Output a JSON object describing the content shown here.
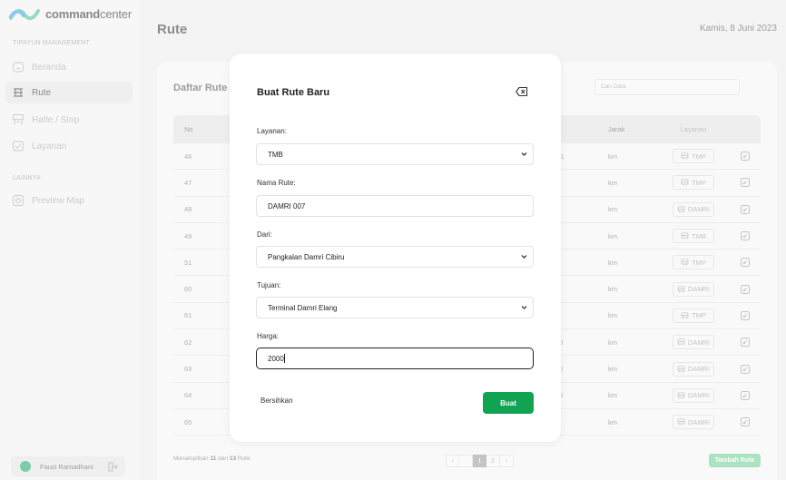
{
  "app": {
    "name_bold": "command",
    "name_rest": "center"
  },
  "sidebar": {
    "section_main": "TIPAYUN MANAGEMENT",
    "items": [
      {
        "label": "Beranda",
        "icon": "home-icon"
      },
      {
        "label": "Rute",
        "icon": "route-icon",
        "active": true
      },
      {
        "label": "Halte / Stop",
        "icon": "bus-stop-icon"
      },
      {
        "label": "Layanan",
        "icon": "service-icon"
      }
    ],
    "section_other": "LAINNYA",
    "other_items": [
      {
        "label": "Preview Map",
        "icon": "map-icon"
      }
    ],
    "user": {
      "name": "Fauzi Ramadhani"
    }
  },
  "header": {
    "title": "Rute",
    "date": "Kamis, 8 Juni 2023"
  },
  "card": {
    "title": "Daftar Rute",
    "search_placeholder": "Cari Data",
    "columns": {
      "no": "No",
      "jarak": "Jarak",
      "layanan": "Layanan"
    },
    "rows": [
      {
        "no": "46",
        "dari": "l1",
        "jarak": "km",
        "layanan": "TMP"
      },
      {
        "no": "47",
        "dari": "",
        "jarak": "km",
        "layanan": "TMP"
      },
      {
        "no": "48",
        "dari": "",
        "jarak": "km",
        "layanan": "DAMRI"
      },
      {
        "no": "49",
        "dari": "",
        "jarak": "km",
        "layanan": "TMB"
      },
      {
        "no": "51",
        "dari": "",
        "jarak": "km",
        "layanan": "TMP"
      },
      {
        "no": "60",
        "dari": "",
        "jarak": "km",
        "layanan": "DAMRI"
      },
      {
        "no": "61",
        "dari": "",
        "jarak": "km",
        "layanan": "TMP"
      },
      {
        "no": "62",
        "dari": "0",
        "jarak": "km",
        "layanan": "DAMRI"
      },
      {
        "no": "63",
        "dari": "0",
        "jarak": "km",
        "layanan": "DAMRI"
      },
      {
        "no": "64",
        "dari": "0",
        "jarak": "km",
        "layanan": "DAMRI"
      },
      {
        "no": "65",
        "dari": "",
        "jarak": "km",
        "layanan": "DAMRI"
      }
    ],
    "footer": {
      "prefix": "Menampilkan",
      "shown": "11",
      "mid": "dari",
      "total": "13",
      "suffix": "Rute"
    },
    "pager": {
      "prev": "‹",
      "p1": "1",
      "p2": "2",
      "next": "›"
    },
    "add_label": "Tambah Rute"
  },
  "modal": {
    "title": "Buat Rute Baru",
    "layanan_label": "Layanan:",
    "layanan_value": "TMB",
    "nama_label": "Nama Rute:",
    "nama_value": "DAMRI 007",
    "dari_label": "Dari:",
    "dari_value": "Pangkalan Damri Cibiru",
    "tujuan_label": "Tujuan:",
    "tujuan_value": "Terminal Damri Elang",
    "harga_label": "Harga:",
    "harga_value": "2000",
    "clear_label": "Bersihkan",
    "submit_label": "Buat"
  }
}
